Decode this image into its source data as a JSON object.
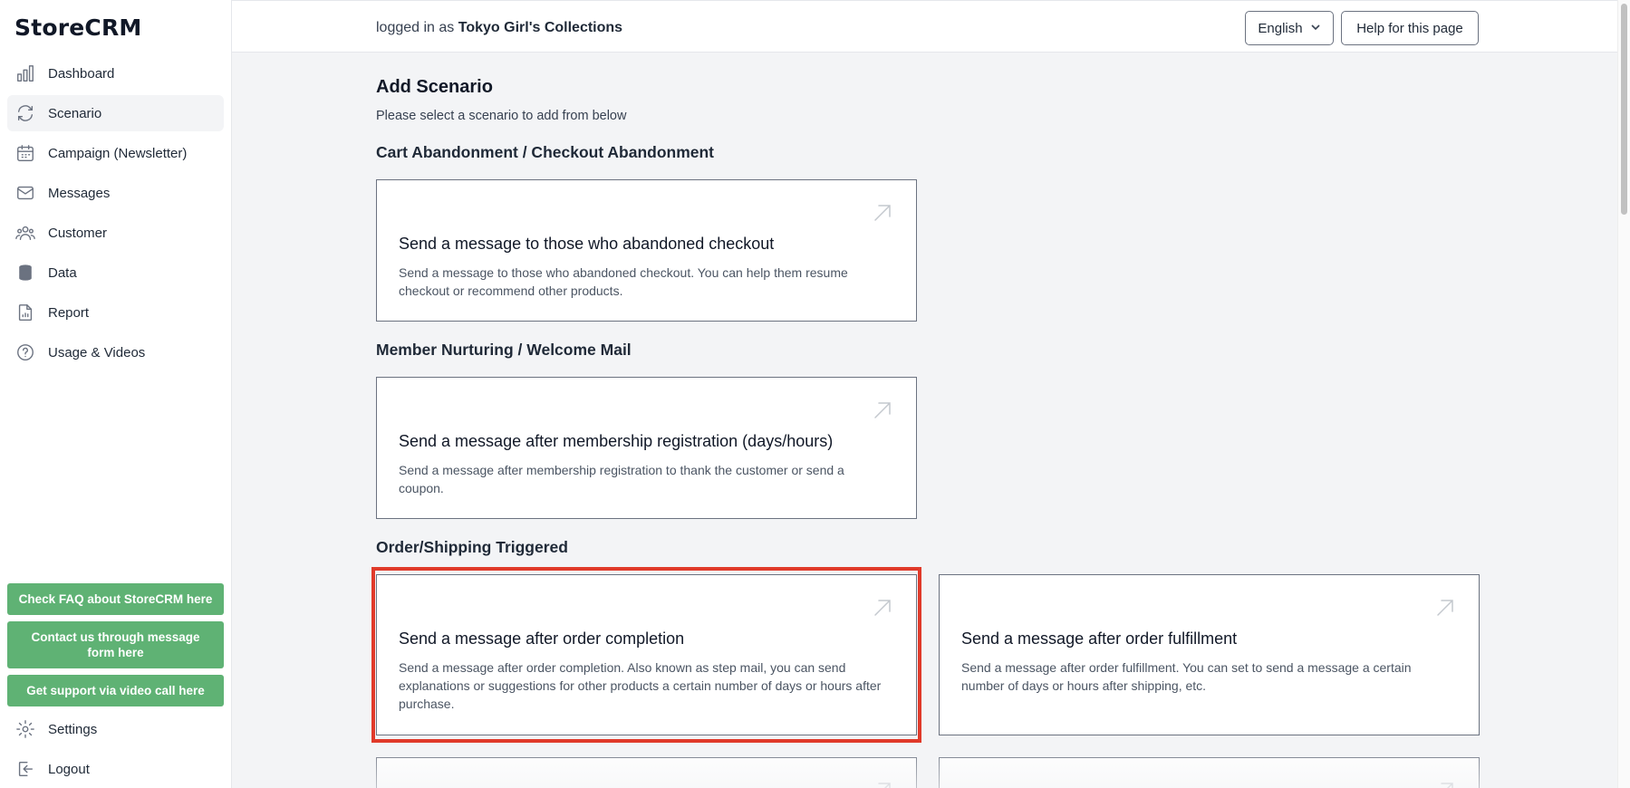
{
  "app": {
    "logo": "StoreCRM"
  },
  "sidebar": {
    "items": [
      {
        "label": "Dashboard",
        "icon": "bar-chart-icon",
        "active": false
      },
      {
        "label": "Scenario",
        "icon": "refresh-icon",
        "active": true
      },
      {
        "label": "Campaign (Newsletter)",
        "icon": "calendar-icon",
        "active": false
      },
      {
        "label": "Messages",
        "icon": "envelope-icon",
        "active": false
      },
      {
        "label": "Customer",
        "icon": "users-icon",
        "active": false
      },
      {
        "label": "Data",
        "icon": "database-icon",
        "active": false
      },
      {
        "label": "Report",
        "icon": "document-chart-icon",
        "active": false
      },
      {
        "label": "Usage & Videos",
        "icon": "question-circle-icon",
        "active": false
      }
    ],
    "support": {
      "faq": "Check FAQ about StoreCRM here",
      "contact": "Contact us through message form here",
      "video": "Get support via video call here"
    },
    "bottom": {
      "settings": "Settings",
      "logout": "Logout"
    }
  },
  "header": {
    "login_prefix": "logged in as",
    "store_name": "Tokyo Girl's Collections",
    "language": "English",
    "help": "Help for this page"
  },
  "page": {
    "title": "Add Scenario",
    "subtitle": "Please select a scenario to add from below",
    "sections": [
      {
        "title": "Cart Abandonment / Checkout Abandonment",
        "cards": [
          {
            "title": "Send a message to those who abandoned checkout",
            "description": "Send a message to those who abandoned checkout. You can help them resume checkout or recommend other products."
          }
        ]
      },
      {
        "title": "Member Nurturing / Welcome Mail",
        "cards": [
          {
            "title": "Send a message after membership registration (days/hours)",
            "description": "Send a message after membership registration to thank the customer or send a coupon."
          }
        ]
      },
      {
        "title": "Order/Shipping Triggered",
        "cards": [
          {
            "title": "Send a message after order completion",
            "description": "Send a message after order completion. Also known as step mail, you can send explanations or suggestions for other products a certain number of days or hours after purchase.",
            "highlighted": true
          },
          {
            "title": "Send a message after order fulfillment",
            "description": "Send a message after order fulfillment. You can set to send a message a certain number of days or hours after shipping, etc."
          }
        ]
      }
    ]
  },
  "colors": {
    "support_button": "#5fb274",
    "highlight": "#e03a2a",
    "active_nav": "#f3f4f6"
  }
}
